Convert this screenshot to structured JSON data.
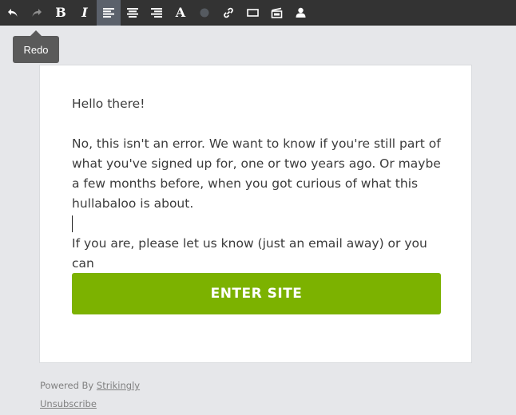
{
  "toolbar": {
    "buttons": [
      {
        "name": "undo",
        "icon": "undo-icon"
      },
      {
        "name": "redo",
        "icon": "redo-icon"
      },
      {
        "name": "bold",
        "glyph": "B"
      },
      {
        "name": "italic",
        "glyph": "I"
      },
      {
        "name": "align-left",
        "icon": "align-left-icon"
      },
      {
        "name": "align-center",
        "icon": "align-center-icon"
      },
      {
        "name": "align-right",
        "icon": "align-right-icon"
      },
      {
        "name": "font",
        "glyph": "A"
      },
      {
        "name": "color",
        "icon": "color-dot-icon"
      },
      {
        "name": "link",
        "icon": "link-icon"
      },
      {
        "name": "button",
        "icon": "button-icon"
      },
      {
        "name": "media",
        "icon": "media-icon"
      },
      {
        "name": "user",
        "icon": "user-icon"
      }
    ],
    "active_button": "align-left"
  },
  "tooltip": {
    "label": "Redo"
  },
  "email": {
    "greeting": "Hello there!",
    "paragraph1": "No, this isn't an error. We want to know if you're still part of what you've signed up for, one or two years ago. Or maybe a few months before, when you got curious of what this hullabaloo is about.",
    "paragraph2": "If  you are, please let us know (just an email away) or you can",
    "cta_label": "ENTER SITE"
  },
  "footer": {
    "powered_prefix": "Powered By ",
    "powered_link": "Strikingly",
    "unsubscribe": "Unsubscribe"
  },
  "colors": {
    "toolbar_bg": "#333333",
    "active_button_bg": "#5b616b",
    "page_bg": "#e6e7ea",
    "cta_bg": "#7cb200",
    "tooltip_bg": "#5a5a5a"
  }
}
